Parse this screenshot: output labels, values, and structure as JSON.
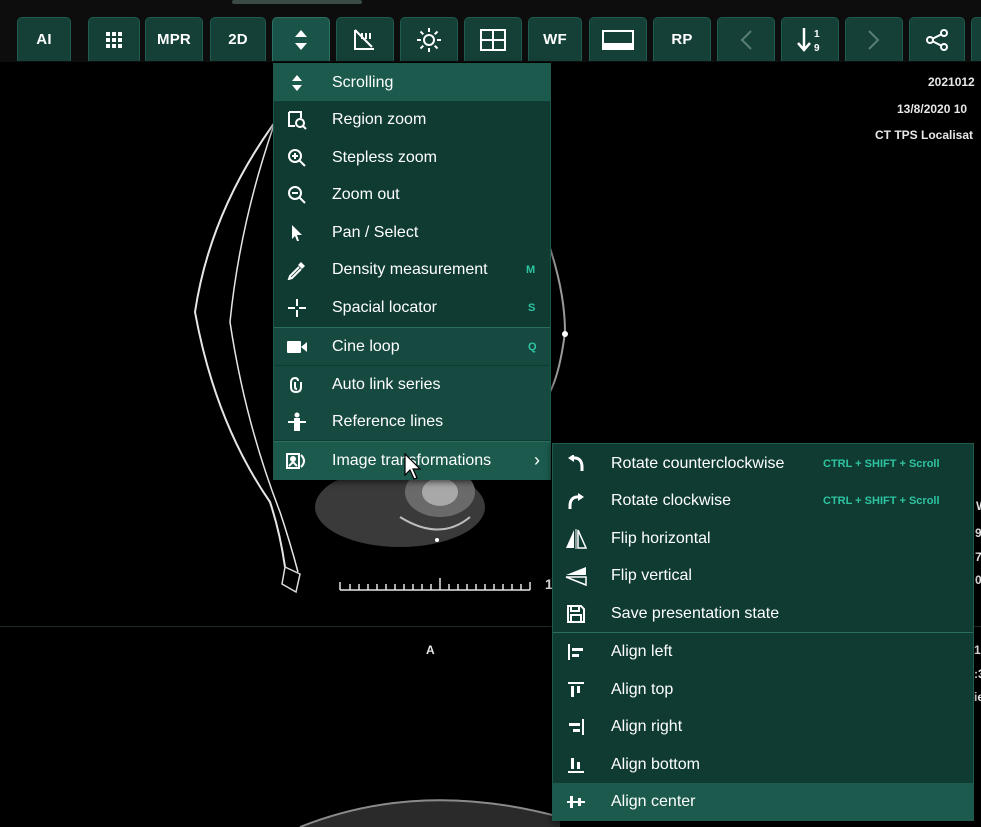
{
  "toolbar": {
    "buttons": [
      {
        "id": "ai",
        "label": "AI"
      },
      {
        "id": "grid",
        "icon": "grid-dots-icon"
      },
      {
        "id": "mpr",
        "label": "MPR"
      },
      {
        "id": "2d",
        "label": "2D"
      },
      {
        "id": "scroll",
        "icon": "scroll-arrows-icon"
      },
      {
        "id": "measure",
        "icon": "ruler-angle-icon"
      },
      {
        "id": "brightness",
        "icon": "brightness-icon"
      },
      {
        "id": "layout",
        "icon": "layout-grid-icon"
      },
      {
        "id": "wf",
        "label": "WF"
      },
      {
        "id": "window",
        "icon": "window-icon"
      },
      {
        "id": "rp",
        "label": "RP"
      },
      {
        "id": "prev",
        "icon": "chevron-left-icon"
      },
      {
        "id": "sort",
        "icon": "sort-1-9-icon"
      },
      {
        "id": "next",
        "icon": "chevron-right-icon"
      },
      {
        "id": "share",
        "icon": "share-icon"
      }
    ]
  },
  "overlay": {
    "date1": "2021012",
    "date2": "13/8/2020 10",
    "series": "CT TPS Localisat",
    "orientation_a": "A",
    "ruler_label": "1",
    "right_w": "W",
    "right_9": "9",
    "right_7": "7",
    "right_0": "0",
    "right_1": "1",
    "right_3": ":3",
    "right_ie": "ie"
  },
  "tools_menu": {
    "items": [
      {
        "label": "Scrolling",
        "icon": "scroll-arrows-icon",
        "shortcut": ""
      },
      {
        "label": "Region zoom",
        "icon": "region-zoom-icon",
        "shortcut": ""
      },
      {
        "label": "Stepless zoom",
        "icon": "zoom-in-icon",
        "shortcut": ""
      },
      {
        "label": "Zoom out",
        "icon": "zoom-out-icon",
        "shortcut": ""
      },
      {
        "label": "Pan / Select",
        "icon": "pointer-icon",
        "shortcut": ""
      },
      {
        "label": "Density measurement",
        "icon": "eyedropper-icon",
        "shortcut": "M"
      },
      {
        "label": "Spacial locator",
        "icon": "crosshair-icon",
        "shortcut": "S"
      },
      {
        "label": "Cine loop",
        "icon": "video-camera-icon",
        "shortcut": "Q"
      },
      {
        "label": "Auto link series",
        "icon": "link-icon",
        "shortcut": ""
      },
      {
        "label": "Reference lines",
        "icon": "reference-lines-icon",
        "shortcut": ""
      },
      {
        "label": "Image transformations",
        "icon": "image-transform-icon",
        "shortcut": ""
      }
    ],
    "submenu_arrow": "›"
  },
  "transform_menu": {
    "items": [
      {
        "label": "Rotate counterclockwise",
        "icon": "rotate-ccw-icon",
        "shortcut": "CTRL + SHIFT + Scroll"
      },
      {
        "label": "Rotate clockwise",
        "icon": "rotate-cw-icon",
        "shortcut": "CTRL + SHIFT + Scroll"
      },
      {
        "label": "Flip horizontal",
        "icon": "flip-horizontal-icon",
        "shortcut": ""
      },
      {
        "label": "Flip vertical",
        "icon": "flip-vertical-icon",
        "shortcut": ""
      },
      {
        "label": "Save presentation state",
        "icon": "save-icon",
        "shortcut": ""
      },
      {
        "label": "Align left",
        "icon": "align-left-icon",
        "shortcut": ""
      },
      {
        "label": "Align top",
        "icon": "align-top-icon",
        "shortcut": ""
      },
      {
        "label": "Align right",
        "icon": "align-right-icon",
        "shortcut": ""
      },
      {
        "label": "Align bottom",
        "icon": "align-bottom-icon",
        "shortcut": ""
      },
      {
        "label": "Align center",
        "icon": "align-center-icon",
        "shortcut": ""
      }
    ]
  },
  "colors": {
    "menu_bg": "#0f3b33",
    "menu_highlight": "#1b5a4c",
    "shortcut": "#2ec4a0",
    "toolbar_button": "#144038"
  }
}
